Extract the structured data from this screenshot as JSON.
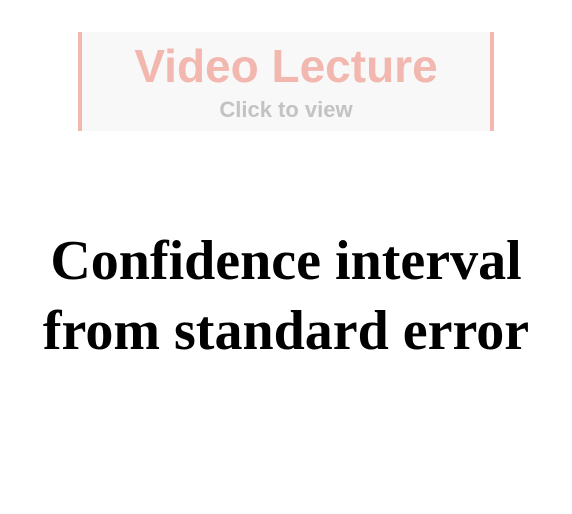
{
  "video_banner": {
    "title": "Video Lecture",
    "subtitle": "Click to view",
    "accent_color": "#f2b8b0"
  },
  "heading": {
    "line1": "Confidence interval",
    "line2": "from standard error"
  }
}
